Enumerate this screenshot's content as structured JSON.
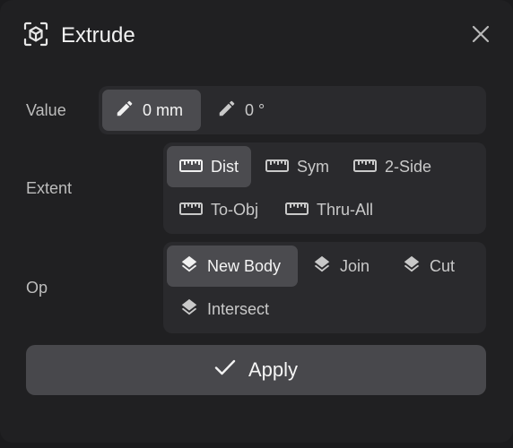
{
  "dialog": {
    "title": "Extrude",
    "icon": "extrude-cube-icon",
    "close_icon": "close-icon"
  },
  "value_row": {
    "label": "Value",
    "options": [
      {
        "label": "0 mm",
        "icon": "pencil-icon",
        "active": true
      },
      {
        "label": "0 °",
        "icon": "pencil-icon",
        "active": false
      }
    ]
  },
  "extent_row": {
    "label": "Extent",
    "options": [
      {
        "label": "Dist",
        "icon": "ruler-icon",
        "active": true
      },
      {
        "label": "Sym",
        "icon": "ruler-icon",
        "active": false
      },
      {
        "label": "2-Side",
        "icon": "ruler-icon",
        "active": false
      },
      {
        "label": "To-Obj",
        "icon": "ruler-icon",
        "active": false
      },
      {
        "label": "Thru-All",
        "icon": "ruler-icon",
        "active": false
      }
    ]
  },
  "op_row": {
    "label": "Op",
    "options": [
      {
        "label": "New Body",
        "icon": "layers-icon",
        "active": true
      },
      {
        "label": "Join",
        "icon": "layers-icon",
        "active": false
      },
      {
        "label": "Cut",
        "icon": "layers-icon",
        "active": false
      },
      {
        "label": "Intersect",
        "icon": "layers-icon",
        "active": false
      }
    ]
  },
  "apply_button": {
    "label": "Apply",
    "icon": "checkmark-icon"
  },
  "colors": {
    "panel": "#202022",
    "group": "#2a2a2d",
    "active_segment": "#4b4b4f",
    "apply_button": "#48484c"
  }
}
